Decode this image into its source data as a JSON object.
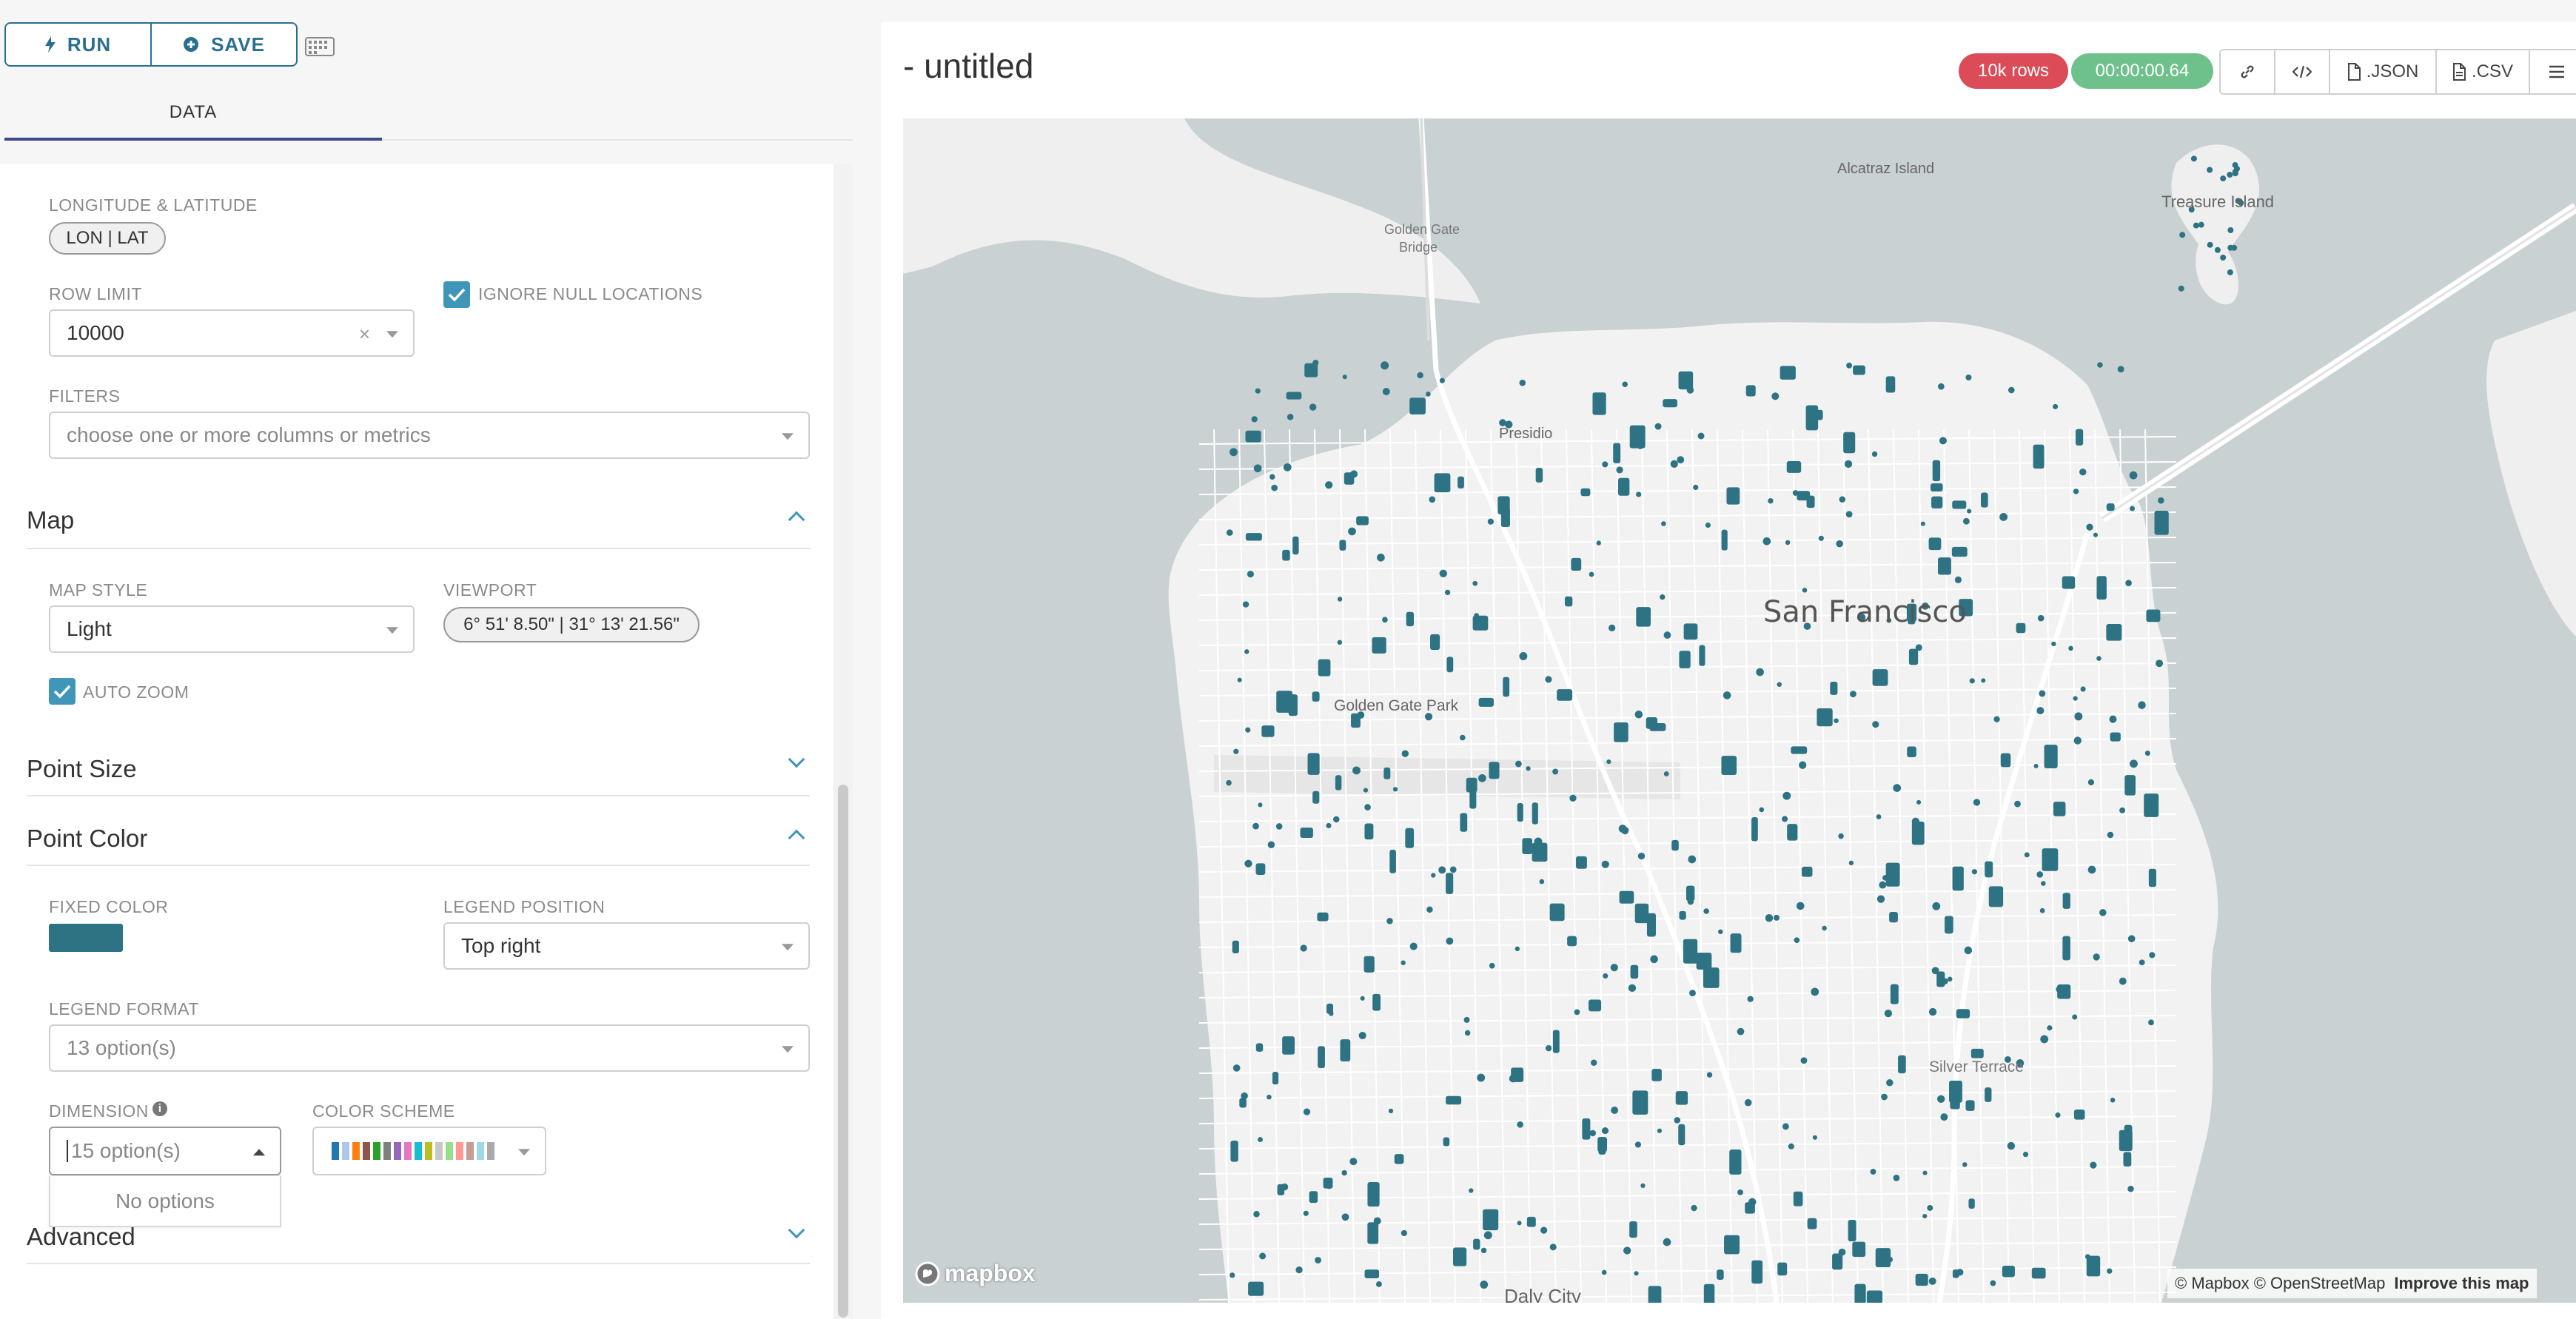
{
  "toolbar": {
    "run_label": "RUN",
    "save_label": "SAVE"
  },
  "tabs": {
    "data_label": "DATA"
  },
  "query": {
    "lonlat_label": "LONGITUDE & LATITUDE",
    "lonlat_value": "LON | LAT",
    "row_limit_label": "ROW LIMIT",
    "row_limit_value": "10000",
    "ignore_null_label": "IGNORE NULL LOCATIONS",
    "filters_label": "FILTERS",
    "filters_placeholder": "choose one or more columns or metrics"
  },
  "map_section": {
    "title": "Map",
    "map_style_label": "MAP STYLE",
    "map_style_value": "Light",
    "viewport_label": "VIEWPORT",
    "viewport_value": "6° 51' 8.50\" | 31° 13' 21.56\"",
    "auto_zoom_label": "AUTO ZOOM"
  },
  "point_size": {
    "title": "Point Size"
  },
  "point_color": {
    "title": "Point Color",
    "fixed_color_label": "FIXED COLOR",
    "fixed_color": "#2e7384",
    "legend_position_label": "LEGEND POSITION",
    "legend_position_value": "Top right",
    "legend_format_label": "LEGEND FORMAT",
    "legend_format_value": "13 option(s)",
    "dimension_label": "DIMENSION",
    "dimension_value": "15 option(s)",
    "dimension_dropdown": "No options",
    "color_scheme_label": "COLOR SCHEME",
    "color_scheme_colors": [
      "#1f77b4",
      "#aec7e8",
      "#ff7f0e",
      "#8c564b",
      "#2ca02c",
      "#7f7f7f",
      "#9467bd",
      "#e377c2",
      "#17becf",
      "#bcbd22",
      "#c7c7c7",
      "#98df8a",
      "#ff9896",
      "#c49c94",
      "#9edae5",
      "#aaaaaa"
    ]
  },
  "advanced": {
    "title": "Advanced"
  },
  "header": {
    "title": "- untitled",
    "rows_badge": "10k rows",
    "time_badge": "00:00:00.64",
    "json_label": ".JSON",
    "csv_label": ".CSV"
  },
  "map": {
    "labels": {
      "alcatraz": "Alcatraz Island",
      "treasure": "Treasure Island",
      "ggb_1": "Golden Gate",
      "ggb_2": "Bridge",
      "presidio": "Presidio",
      "sf": "San Francisco",
      "ggpark": "Golden Gate Park",
      "silver": "Silver Terrace",
      "daly": "Daly City"
    },
    "logo": "mapbox",
    "attribution": "© Mapbox © OpenStreetMap",
    "improve": "Improve this map",
    "point_color": "#2e7384"
  },
  "colors": {
    "accent": "#2a6f8f",
    "danger": "#dc4b58",
    "success": "#6ec18b"
  }
}
